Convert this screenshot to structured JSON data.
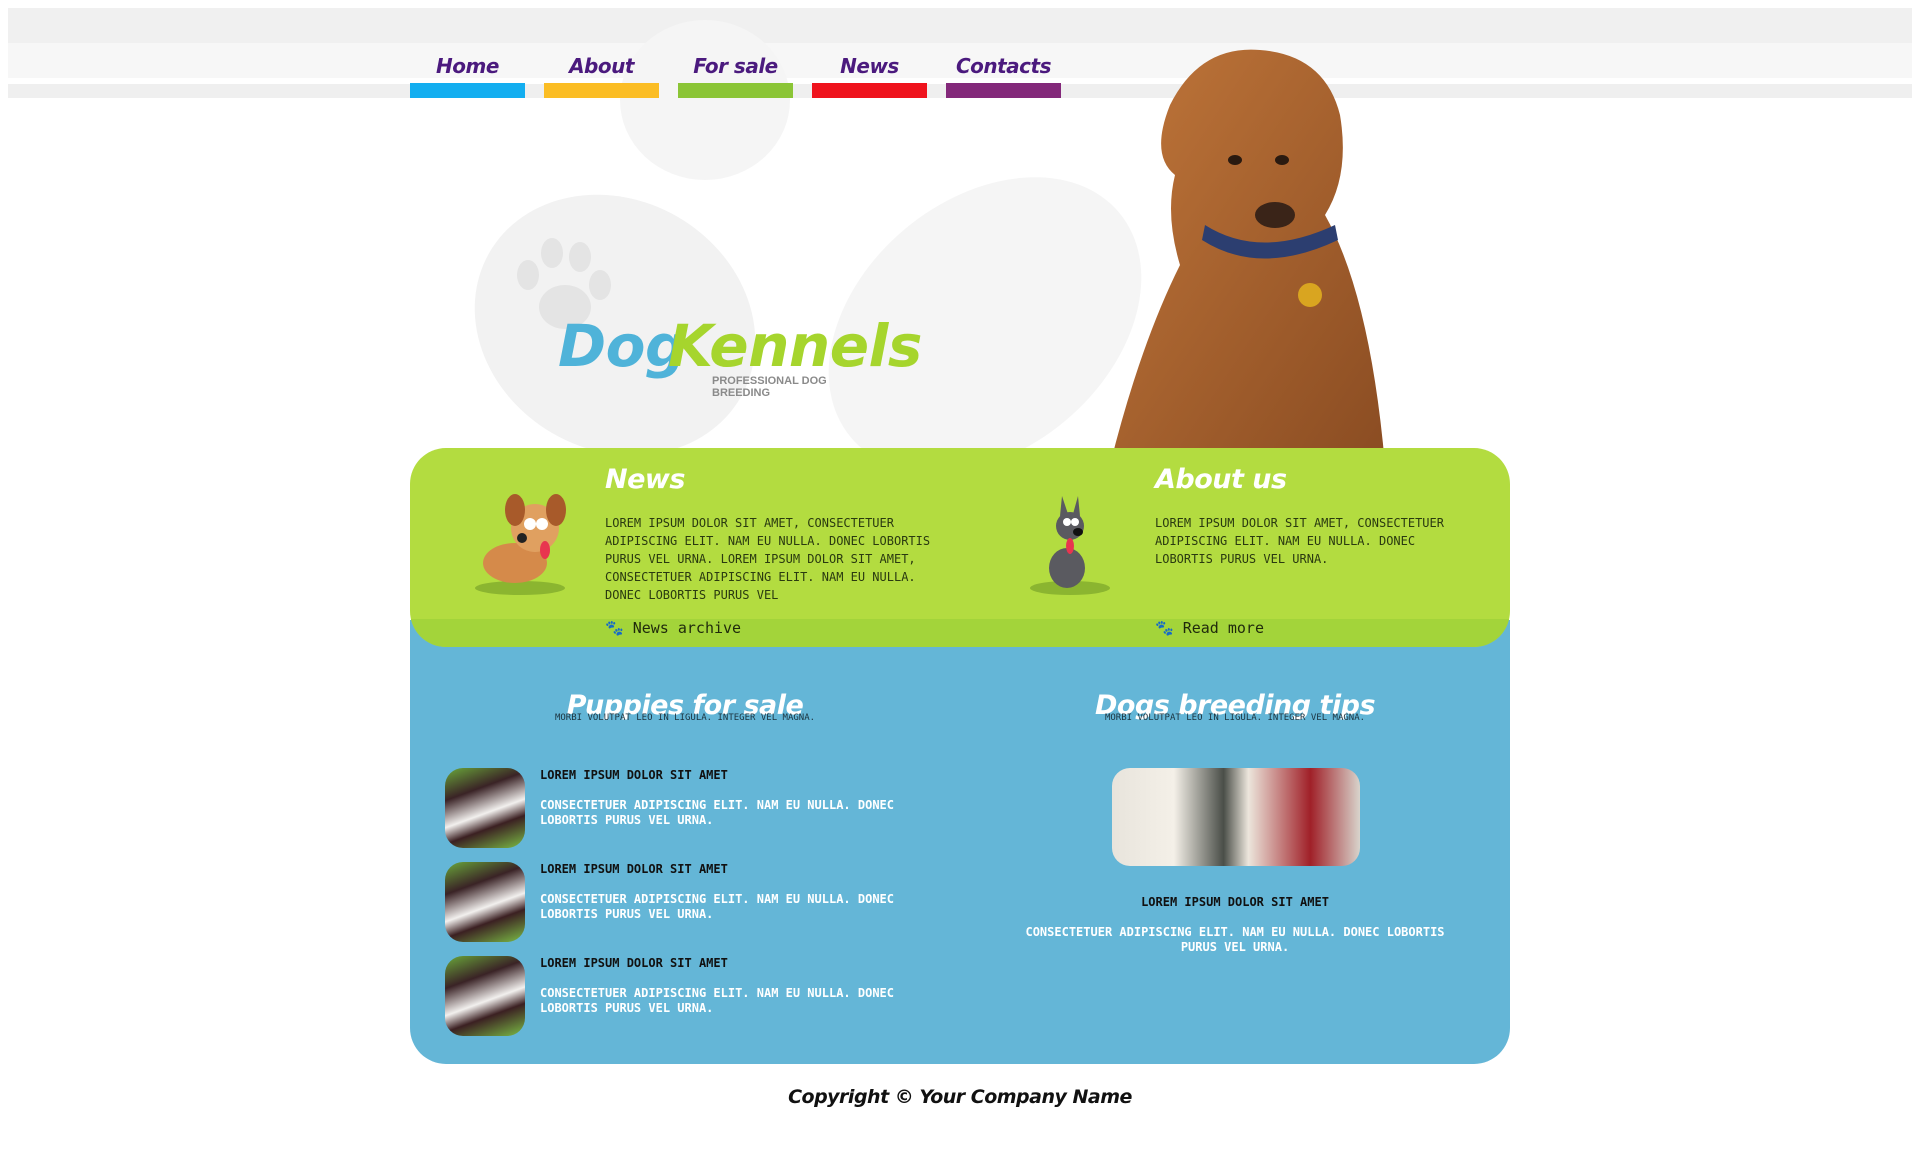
{
  "nav": {
    "items": [
      {
        "label": "Home",
        "color": "#13aef0"
      },
      {
        "label": "About",
        "color": "#fbbd24"
      },
      {
        "label": "For sale",
        "color": "#8bc536"
      },
      {
        "label": "News",
        "color": "#ef131d"
      },
      {
        "label": "Contacts",
        "color": "#83287a"
      }
    ]
  },
  "logo": {
    "part1": "Dog",
    "part2": "Kennels",
    "tagline": "PROFESSIONAL DOG BREEDING"
  },
  "news": {
    "title": "News",
    "text": "Lorem ipsum dolor sit amet, consectetuer adipiscing elit. Nam eu nulla. Donec lobortis purus vel urna. Lorem ipsum dolor sit amet, consectetuer adipiscing elit. Nam eu nulla. Donec lobortis purus vel",
    "link": "News archive"
  },
  "about": {
    "title": "About us",
    "text": "Lorem ipsum dolor sit amet, consectetuer adipiscing elit. Nam eu nulla. Donec lobortis purus vel urna.",
    "link": "Read more"
  },
  "puppies": {
    "title": "Puppies for sale",
    "subtitle": "MORBI VOLUTPAT LEO IN LIGULA. INTEGER VEL MAGNA.",
    "items": [
      {
        "title": "LOREM IPSUM DOLOR SIT AMET",
        "text": "CONSECTETUER ADIPISCING ELIT. NAM EU NULLA. DONEC LOBORTIS PURUS VEL URNA."
      },
      {
        "title": "LOREM IPSUM DOLOR SIT AMET",
        "text": "CONSECTETUER ADIPISCING ELIT. NAM EU NULLA. DONEC LOBORTIS PURUS VEL URNA."
      },
      {
        "title": "LOREM IPSUM DOLOR SIT AMET",
        "text": "CONSECTETUER ADIPISCING ELIT. NAM EU NULLA. DONEC LOBORTIS PURUS VEL URNA."
      }
    ]
  },
  "tips": {
    "title": "Dogs breeding tips",
    "subtitle": "MORBI VOLUTPAT LEO IN LIGULA. INTEGER VEL MAGNA.",
    "item_title": "LOREM IPSUM DOLOR SIT AMET",
    "item_text": "CONSECTETUER ADIPISCING ELIT. NAM EU NULLA. DONEC LOBORTIS PURUS VEL URNA."
  },
  "footer": {
    "copyright": "Copyright © Your Company Name"
  },
  "colors": {
    "green": "#b3dc40",
    "blue": "#64b6d7",
    "nav_text": "#4b1a7e"
  }
}
